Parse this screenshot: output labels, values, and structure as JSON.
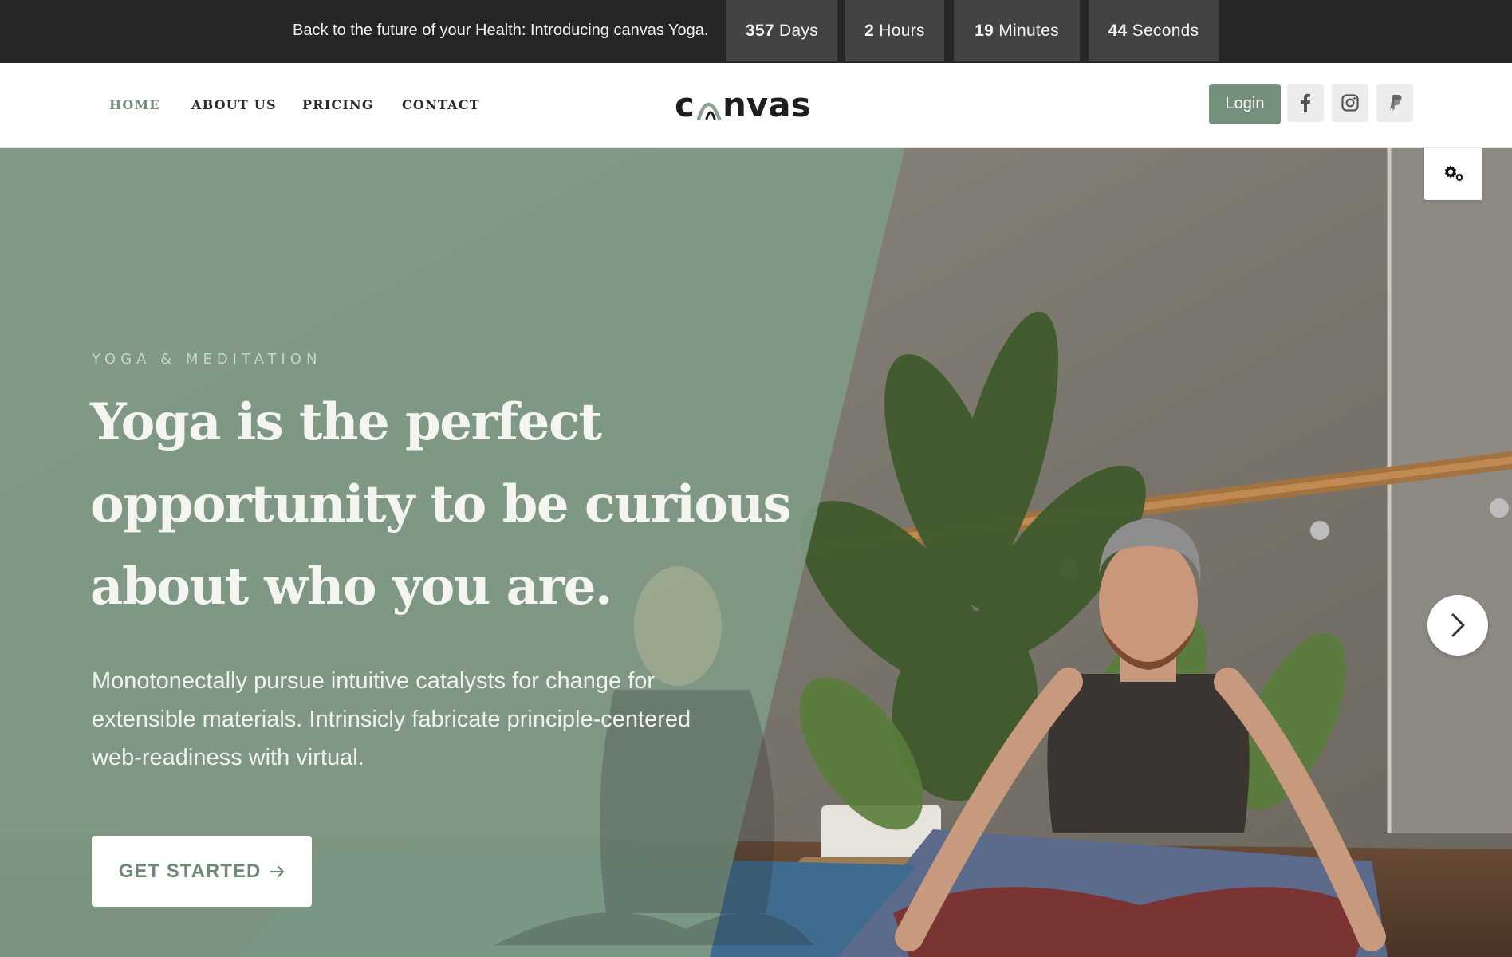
{
  "announcement": {
    "message": "Back to the future of your Health: Introducing canvas Yoga.",
    "countdown": [
      {
        "value": "357",
        "unit": "Days"
      },
      {
        "value": "2",
        "unit": "Hours"
      },
      {
        "value": "19",
        "unit": "Minutes"
      },
      {
        "value": "44",
        "unit": "Seconds"
      }
    ]
  },
  "nav": {
    "items": [
      {
        "label": "HOME",
        "active": true
      },
      {
        "label": "ABOUT US",
        "active": false
      },
      {
        "label": "PRICING",
        "active": false
      },
      {
        "label": "CONTACT",
        "active": false
      }
    ]
  },
  "logo": {
    "text": "canvas"
  },
  "header_actions": {
    "login_label": "Login",
    "social_icons": [
      "facebook-icon",
      "instagram-icon",
      "paypal-icon"
    ]
  },
  "hero": {
    "eyebrow": "YOGA & MEDITATION",
    "headline_lines": [
      "Yoga is the perfect",
      "opportunity to be curious",
      "about who you are."
    ],
    "lead_lines": [
      "Monotonectally pursue intuitive catalysts for change for",
      "extensible materials. Intrinsicly fabricate principle-centered",
      "web-readiness with virtual."
    ],
    "cta_label": "GET STARTED",
    "cta_icon": "arrow-right-icon",
    "next_icon": "chevron-right-icon",
    "settings_icon": "gears-icon"
  },
  "colors": {
    "accent": "#75907a",
    "topbar_bg": "#262626",
    "countdown_bg": "#434343",
    "hero_overlay": "#7f9a84"
  }
}
